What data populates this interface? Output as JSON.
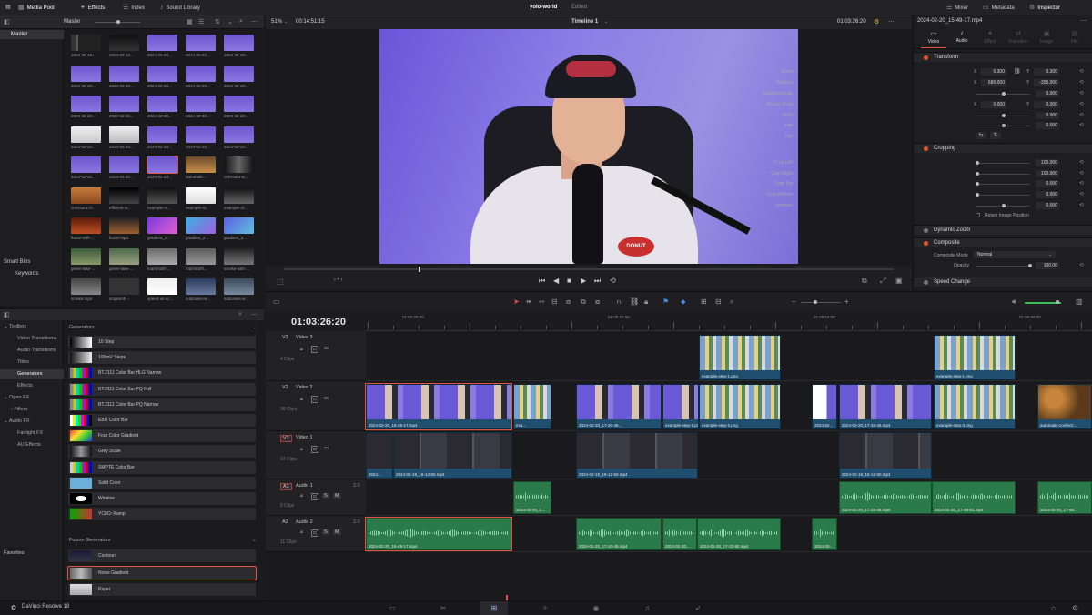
{
  "topbar": {
    "media_pool": "Media Pool",
    "effects": "Effects",
    "index": "Index",
    "sound_library": "Sound Library",
    "project_name": "yolo-world",
    "project_status": "Edited",
    "mixer": "Mixer",
    "metadata": "Metadata",
    "inspector": "Inspector"
  },
  "media_pool": {
    "bin_title": "Master",
    "bins": {
      "master": "Master",
      "smart_bins": "Smart Bins",
      "keywords": "Keywords"
    },
    "clips": [
      "2024-02-19...",
      "2024-02-19...",
      "2024-02-20...",
      "2024-02-20...",
      "2024-02-20...",
      "2024-02-20...",
      "2024-02-20...",
      "2024-02-20...",
      "2024-02-20...",
      "2024-02-20...",
      "2024-02-20...",
      "2024-02-20...",
      "2024-02-20...",
      "2024-02-20...",
      "2024-02-20...",
      "2024-02-20...",
      "2024-02-20...",
      "2024-02-20...",
      "2024-02-20...",
      "2024-02-20...",
      "2024-02-20...",
      "2024-02-20...",
      "2024-02-20...",
      "automatic-...",
      "croissant-w...",
      "croissant.m...",
      "efficient-w...",
      "example-st...",
      "example-st...",
      "example-st...",
      "flame-with-...",
      "flame.mp4",
      "gradient_1...",
      "gradient_2...",
      "gradient_3...",
      "green-lake-...",
      "green-lake-...",
      "mammoth-...",
      "mammoth...",
      "smoke-with-...",
      "smoke.mp4",
      "smplomh -...",
      "speed-vs-ac...",
      "suitcases-w...",
      "suitcases-w..."
    ]
  },
  "effects": {
    "tree": {
      "toolbox": "Toolbox",
      "video_transitions": "Video Transitions",
      "audio_transitions": "Audio Transitions",
      "titles": "Titles",
      "generators": "Generators",
      "effects": "Effects",
      "open_fx": "Open FX",
      "filters": "Filters",
      "audio_fx": "Audio FX",
      "fairlight_fx": "Fairlight FX",
      "au_effects": "AU Effects",
      "favorites": "Favorites"
    },
    "generators_title": "Generators",
    "generators": [
      "10 Step",
      "100mV Steps",
      "BT.2111 Color Bar HLG Narrow",
      "BT.2111 Color Bar PQ Full",
      "BT.2111 Color Bar PQ Narrow",
      "EBU Color Bar",
      "Four Color Gradient",
      "Grey Scale",
      "SMPTE Color Bar",
      "Solid Color",
      "Window",
      "YCbCr Ramp"
    ],
    "fusion_title": "Fusion Generators",
    "fusion": [
      "Contours",
      "Noise Gradient",
      "Paper"
    ]
  },
  "viewer": {
    "zoom": "51%",
    "source_tc": "00:14:51:15",
    "timeline_name": "Timeline 1",
    "record_tc": "01:03:26:20",
    "shirt_text": "DONUT"
  },
  "inspector": {
    "clip_name": "2024-02-20_15-49-17.mp4",
    "tabs": [
      "Video",
      "Audio",
      "Effect",
      "Transition",
      "Image",
      "File"
    ],
    "transform": {
      "title": "Transform",
      "zoom_label": "Zoom",
      "zoom_x": "0.300",
      "zoom_y": "0.300",
      "position_label": "Position",
      "pos_x": "680.000",
      "pos_y": "-355.000",
      "rotation_label": "Rotation Angle",
      "rotation": "0.000",
      "anchor_label": "Anchor Point",
      "anchor_x": "0.000",
      "anchor_y": "0.000",
      "pitch_label": "Pitch",
      "pitch": "0.000",
      "yaw_label": "Yaw",
      "yaw": "0.000",
      "flip_label": "Flip",
      "x": "X",
      "y": "Y"
    },
    "cropping": {
      "title": "Cropping",
      "left_label": "Crop Left",
      "left": "100.000",
      "right_label": "Crop Right",
      "right": "100.000",
      "top_label": "Crop Top",
      "top": "0.000",
      "bottom_label": "Crop Bottom",
      "bottom": "0.000",
      "softness_label": "Softness",
      "softness": "0.000",
      "retain_label": "Retain Image Position"
    },
    "dynamic_zoom": "Dynamic Zoom",
    "composite": {
      "title": "Composite",
      "mode_label": "Composite Mode",
      "mode": "Normal",
      "opacity_label": "Opacity",
      "opacity": "100.00"
    },
    "speed_change": "Speed Change"
  },
  "timeline": {
    "timecode": "01:03:26:20",
    "ruler": [
      "01:04:20:00",
      "01:05:12:00",
      "01:06:04:00",
      "01:06:56:00"
    ],
    "tracks": {
      "v3": {
        "id": "V3",
        "name": "Video 3",
        "count": "4 Clips"
      },
      "v2": {
        "id": "V2",
        "name": "Video 2",
        "count": "36 Clips"
      },
      "v1": {
        "id": "V1",
        "name": "Video 1",
        "count": "42 Clips"
      },
      "a1": {
        "id": "A1",
        "name": "Audio 1",
        "count": "9 Clips",
        "ch": "2.0"
      },
      "a2": {
        "id": "A2",
        "name": "Audio 2",
        "count": "11 Clips",
        "ch": "2.0"
      }
    },
    "clips": {
      "v3a": "example-step-1.png",
      "v3b": "example-step-1.png",
      "v2a": "2024-02-20_15-49-17.mp4",
      "v2b": "exa...",
      "v2c": "2024-02-20_17-20-45...",
      "v2d": "example-step-2.png",
      "v2e": "2024-02...",
      "v2f": "2024-02-20_17-33-46.mp4",
      "v2g": "example-step-3.png",
      "v2h": "automatic-confecti...",
      "v1a": "2024...",
      "v1b": "2024-02-19_16-12-50.mp4",
      "v1c": "2024-02-19_16-12-50.mp4",
      "v1d": "2024-02-19_16-12-50.mp4",
      "a1a": "2024-02-20_1...",
      "a1b": "2024-02-20_17-33-46.mp4",
      "a1c": "2024-02-20_17-38-51.mp4",
      "a1d": "2024-02-20_17-48...",
      "a2a": "2024-02-20_15-49-17.mp4",
      "a2b": "2024-02-20_17-20-45.mp4",
      "a2c": "2024-02-20...",
      "a2d": "2024-02-20_17-22-50.mp4",
      "a2e": "2024-02-..."
    }
  },
  "status": {
    "app": "DaVinci Resolve 18"
  }
}
